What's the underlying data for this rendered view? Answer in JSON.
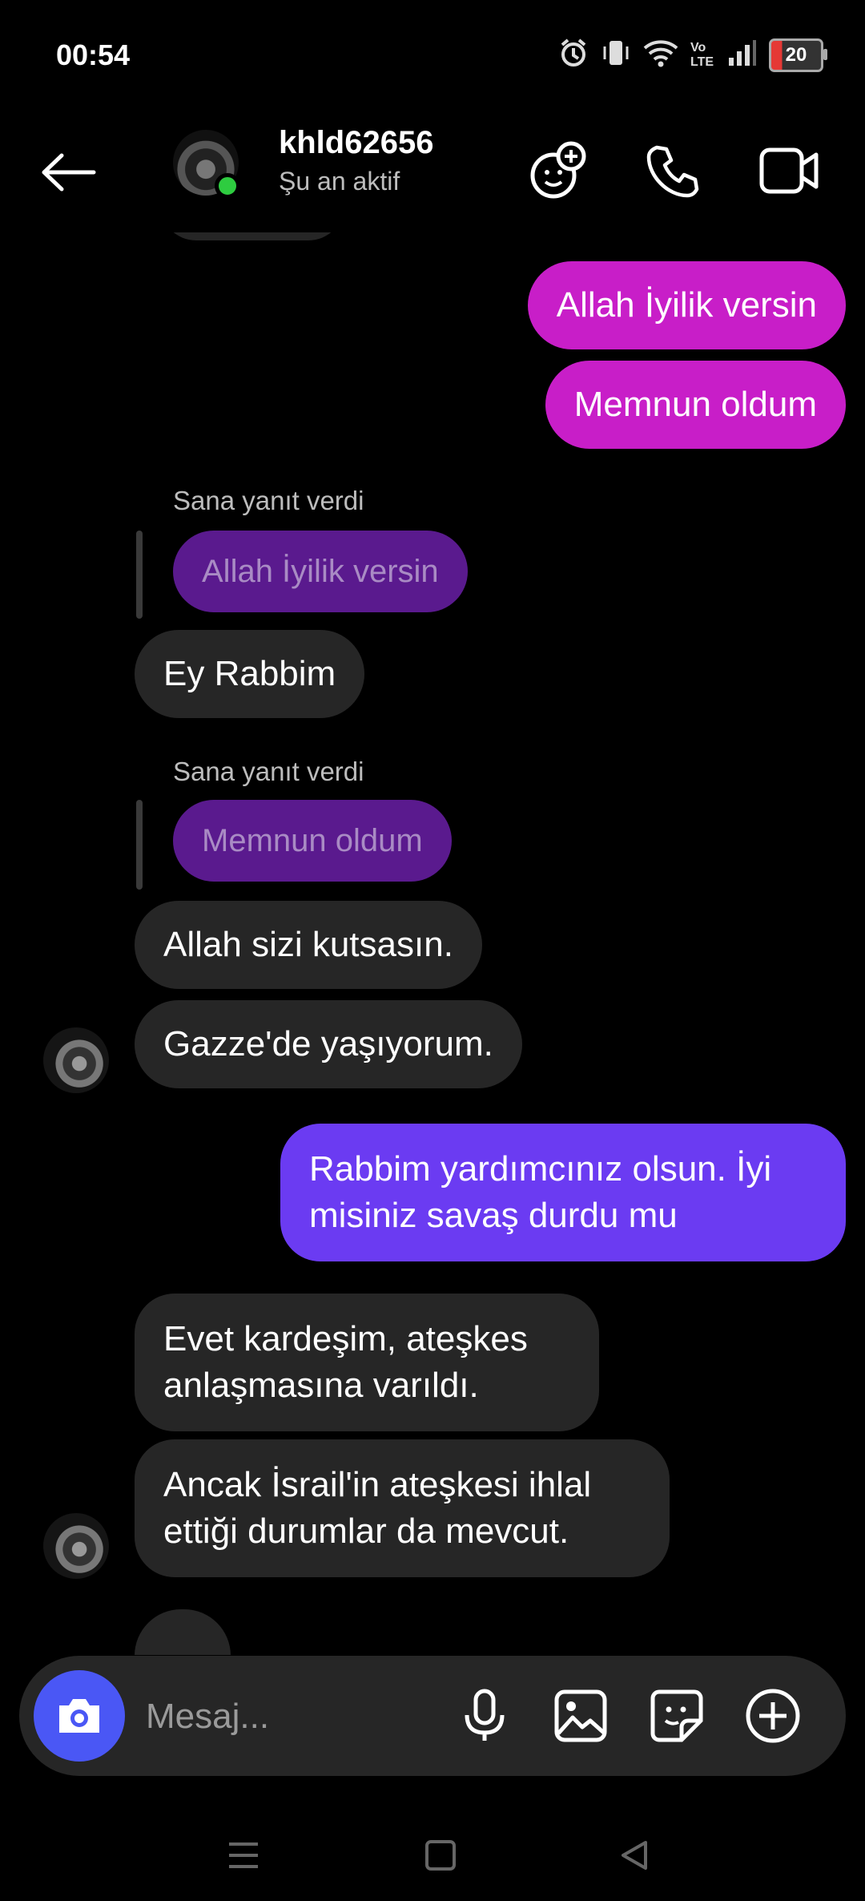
{
  "status_bar": {
    "time": "00:54",
    "battery": "20",
    "network_label": "Vo LTE"
  },
  "header": {
    "username": "khld62656",
    "status": "Şu an aktif"
  },
  "messages": {
    "m1": "Allah İyilik versin",
    "m2": "Memnun oldum",
    "reply1_label": "Sana yanıt verdi",
    "reply1_quote": "Allah İyilik versin",
    "m3": "Ey Rabbim",
    "reply2_label": "Sana yanıt verdi",
    "reply2_quote": "Memnun oldum",
    "m4": "Allah sizi kutsasın.",
    "m5": "Gazze'de yaşıyorum.",
    "m6": "Rabbim yardımcınız olsun. İyi misiniz savaş durdu mu",
    "m7": "Evet kardeşim, ateşkes anlaşmasına varıldı.",
    "m8": "Ancak İsrail'in ateşkesi ihlal ettiği durumlar da mevcut."
  },
  "composer": {
    "placeholder": "Mesaj..."
  },
  "colors": {
    "outgoing_magenta": "#c81ec8",
    "outgoing_purple": "#6b3bf2",
    "incoming": "#262626",
    "camera": "#4a57f5",
    "online": "#2ecc40"
  },
  "icons": [
    "back-arrow-icon",
    "add-friend-effects-icon",
    "phone-icon",
    "video-icon",
    "camera-icon",
    "microphone-icon",
    "gallery-icon",
    "sticker-icon",
    "plus-icon",
    "menu-icon",
    "home-icon",
    "nav-back-icon"
  ]
}
